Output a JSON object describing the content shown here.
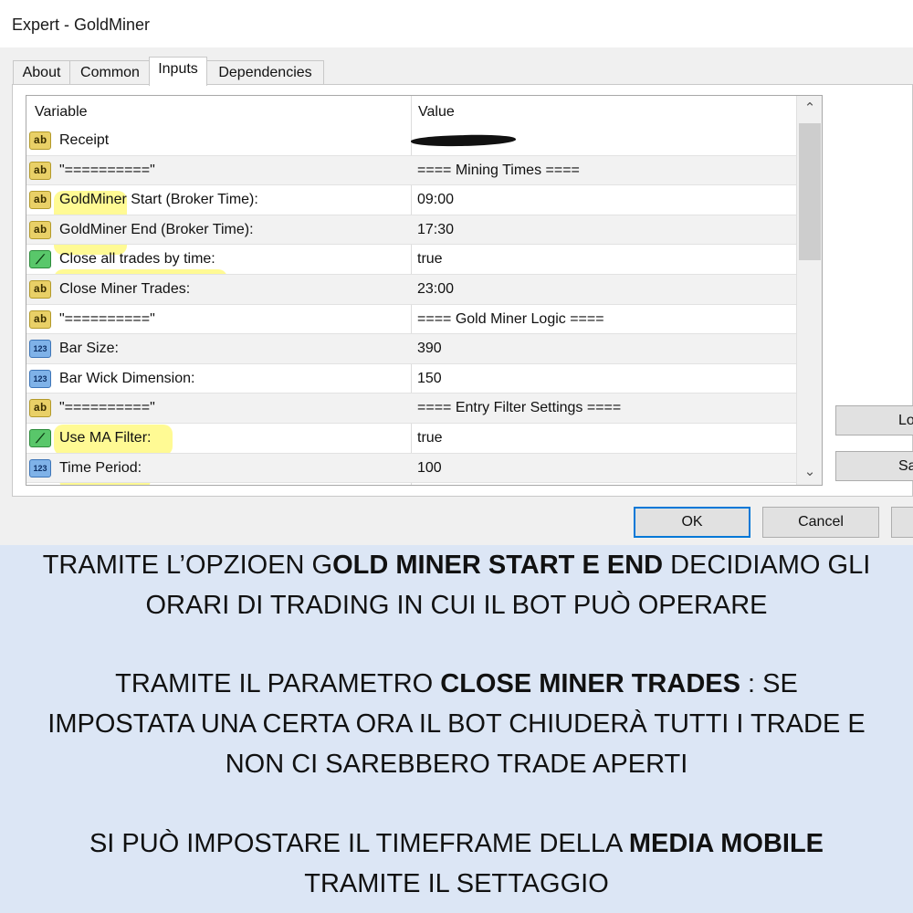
{
  "window": {
    "title": "Expert - GoldMiner"
  },
  "tabs": [
    {
      "label": "About"
    },
    {
      "label": "Common"
    },
    {
      "label": "Inputs"
    },
    {
      "label": "Dependencies"
    }
  ],
  "grid": {
    "headers": {
      "variable": "Variable",
      "value": "Value"
    },
    "rows": [
      {
        "icon": "ab",
        "variable": "Receipt",
        "value": ""
      },
      {
        "icon": "ab",
        "variable": "\"==========\"",
        "value": "==== Mining Times ===="
      },
      {
        "icon": "ab",
        "variable": "GoldMiner Start (Broker Time):",
        "value": "09:00"
      },
      {
        "icon": "ab",
        "variable": "GoldMiner End (Broker Time):",
        "value": "17:30"
      },
      {
        "icon": "bool",
        "variable": "Close all trades by time:",
        "value": "true"
      },
      {
        "icon": "ab",
        "variable": "Close Miner Trades:",
        "value": "23:00"
      },
      {
        "icon": "ab",
        "variable": "\"==========\"",
        "value": "==== Gold Miner Logic ===="
      },
      {
        "icon": "123",
        "variable": "Bar Size:",
        "value": "390"
      },
      {
        "icon": "123",
        "variable": "Bar Wick Dimension:",
        "value": "150"
      },
      {
        "icon": "ab",
        "variable": "\"==========\"",
        "value": "==== Entry Filter Settings ===="
      },
      {
        "icon": "bool",
        "variable": "Use MA Filter:",
        "value": "true"
      },
      {
        "icon": "123",
        "variable": "Time Period:",
        "value": "100"
      }
    ]
  },
  "side_buttons": {
    "load": "Lo",
    "save": "Sa"
  },
  "buttons": {
    "ok": "OK",
    "cancel": "Cancel",
    "extra": ""
  },
  "caption": {
    "p1_a": "TRAMITE L’OPZIOEN G",
    "p1_b": "OLD MINER START E END",
    "p1_c": " DECIDIAMO GLI",
    "p1_d": "ORARI DI TRADING IN CUI IL BOT PUÒ OPERARE",
    "p2_a": "TRAMITE IL PARAMETRO ",
    "p2_b": "CLOSE MINER TRADES",
    "p2_c": " : SE",
    "p2_d": "IMPOSTATA UNA CERTA ORA IL BOT CHIUDERÀ TUTTI I TRADE E",
    "p2_e": "NON CI SAREBBERO TRADE APERTI",
    "p3_a": "SI PUÒ IMPOSTARE IL TIMEFRAME DELLA ",
    "p3_b": "MEDIA MOBILE",
    "p3_c": "TRAMITE IL SETTAGGIO"
  }
}
